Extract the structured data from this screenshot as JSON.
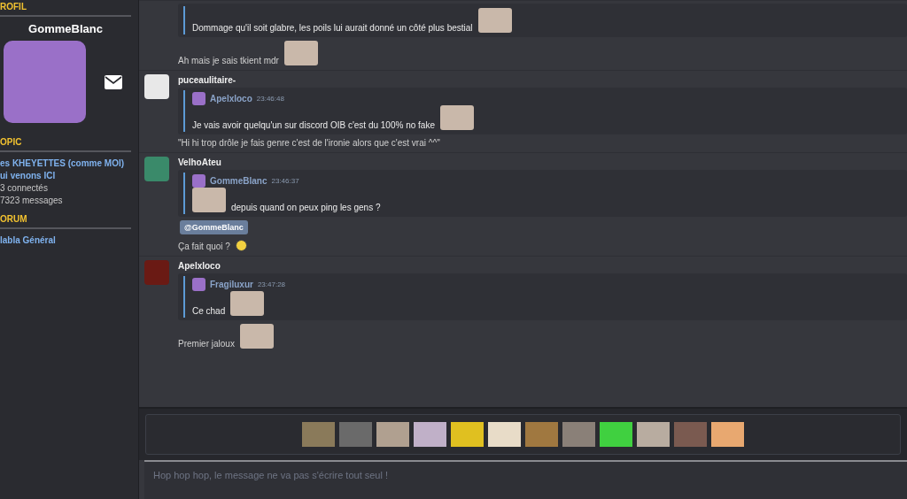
{
  "sidebar": {
    "profile_header": "ROFIL",
    "username": "GommeBlanc",
    "topic_header": "OPIC",
    "topic_title": [
      "es KHEYETTES (comme MOI)",
      "ui venons ICI"
    ],
    "stats": [
      "3 connectés",
      "7323 messages"
    ],
    "forum_header": "ORUM",
    "forum_name": "labla Général"
  },
  "messages": [
    {
      "blocks": [
        {
          "kind": "quote",
          "parts": [
            {
              "kind": "text",
              "text": "Dommage qu'il soit glabre, les poils lui aurait donné un côté plus bestial"
            },
            {
              "kind": "sticker"
            }
          ]
        },
        {
          "kind": "line",
          "parts": [
            {
              "kind": "text",
              "text": "Ah mais je sais tkient mdr"
            },
            {
              "kind": "sticker"
            }
          ]
        }
      ]
    },
    {
      "author": "puceaulitaire-",
      "blocks": [
        {
          "kind": "quote",
          "author": "Apelxloco",
          "time": "23:46:48",
          "parts": [
            {
              "kind": "text",
              "text": "Je vais avoir quelqu'un sur discord OIB c'est du 100% no fake"
            },
            {
              "kind": "sticker"
            }
          ]
        },
        {
          "kind": "line",
          "parts": [
            {
              "kind": "text",
              "text": "\"Hi hi trop drôle je fais genre c'est de l'ironie alors que c'est vrai ^^\""
            }
          ]
        }
      ]
    },
    {
      "author": "VelhoAteu",
      "blocks": [
        {
          "kind": "quote",
          "author": "GommeBlanc",
          "time": "23:46:37",
          "parts": [
            {
              "kind": "sticker"
            },
            {
              "kind": "text",
              "text": "depuis quand on peux ping les gens ?"
            }
          ]
        },
        {
          "kind": "mention",
          "text": "@GommeBlanc"
        },
        {
          "kind": "line",
          "parts": [
            {
              "kind": "text",
              "text": "Ça fait quoi ?"
            },
            {
              "kind": "emoji"
            }
          ]
        }
      ]
    },
    {
      "author": "Apelxloco",
      "blocks": [
        {
          "kind": "quote",
          "author": "Fragiluxur",
          "time": "23:47:28",
          "parts": [
            {
              "kind": "text",
              "text": "Ce chad"
            },
            {
              "kind": "sticker"
            }
          ]
        },
        {
          "kind": "line",
          "parts": [
            {
              "kind": "text",
              "text": "Premier jaloux"
            },
            {
              "kind": "sticker"
            }
          ]
        }
      ]
    }
  ],
  "composer": {
    "placeholder": "Hop hop hop, le message ne va pas s'écrire tout seul !"
  }
}
